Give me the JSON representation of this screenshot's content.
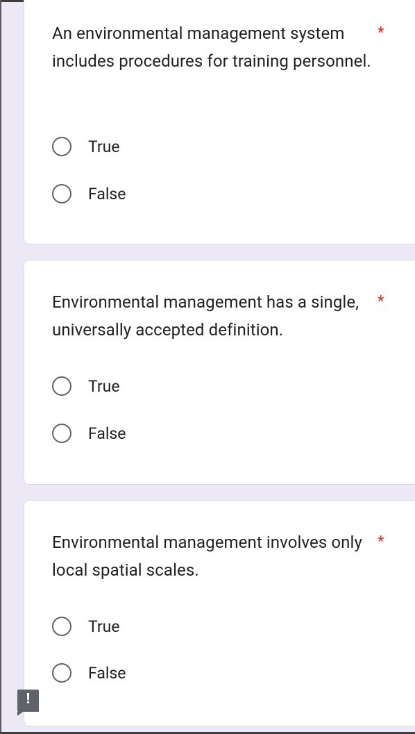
{
  "questions": [
    {
      "text": "An environmental management system includes procedures for training personnel.",
      "required_mark": "*",
      "options": [
        "True",
        "False"
      ]
    },
    {
      "text": "Environmental management has a single, universally accepted definition.",
      "required_mark": "*",
      "options": [
        "True",
        "False"
      ]
    },
    {
      "text": "Environmental management involves only local spatial scales.",
      "required_mark": "*",
      "options": [
        "True",
        "False"
      ]
    }
  ],
  "feedback_button": {
    "glyph": "!",
    "icon": "report-problem-icon"
  },
  "colors": {
    "background": "#ece8f5",
    "required": "#d93025",
    "radio_border": "#5f6368"
  }
}
